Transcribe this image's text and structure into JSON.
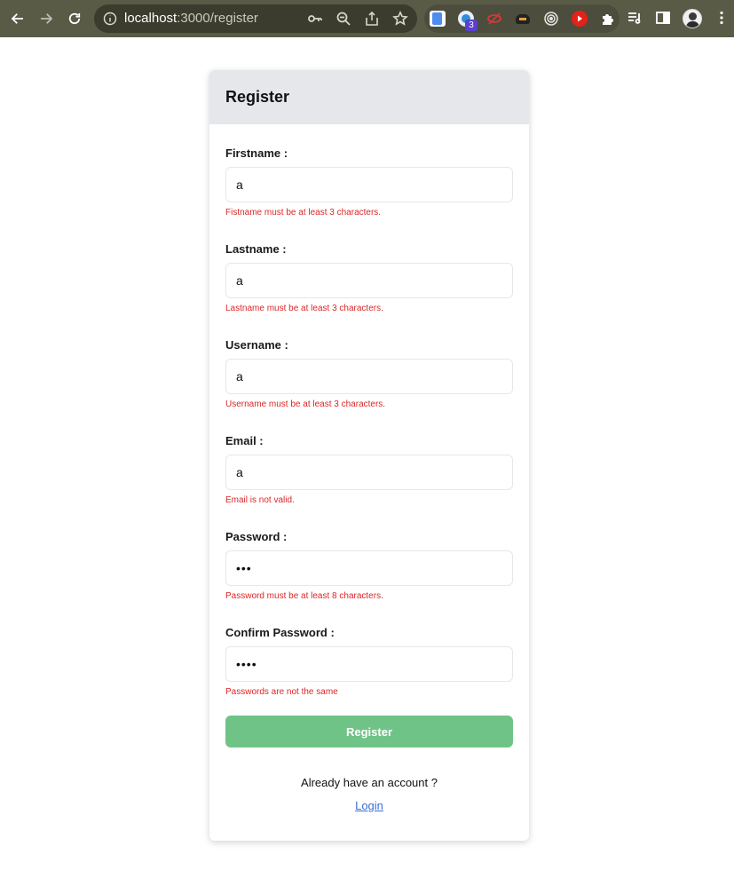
{
  "browser": {
    "url_host": "localhost",
    "url_path": ":3000/register",
    "extension_badge": "3"
  },
  "page": {
    "title": "Register",
    "fields": [
      {
        "label": "Firstname :",
        "value": "a",
        "error": "Fistname must be at least 3 characters."
      },
      {
        "label": "Lastname :",
        "value": "a",
        "error": "Lastname must be at least 3 characters."
      },
      {
        "label": "Username :",
        "value": "a",
        "error": "Username must be at least 3 characters."
      },
      {
        "label": "Email :",
        "value": "a",
        "error": "Email is not valid."
      },
      {
        "label": "Password :",
        "value": "•••",
        "error": "Password must be at least 8 characters."
      },
      {
        "label": "Confirm Password :",
        "value": "••••",
        "error": "Passwords are not the same"
      }
    ],
    "submit_label": "Register",
    "account_prompt": "Already have an account ?",
    "login_link": "Login"
  },
  "colors": {
    "header_bg": "#e5e7eb",
    "error": "#dc2626",
    "submit_bg": "#6fc386",
    "link": "#3b6fd6",
    "chrome_bg": "#5a5b46"
  },
  "icons": [
    "back-arrow-icon",
    "forward-arrow-icon",
    "reload-icon",
    "info-icon",
    "key-icon",
    "zoom-out-icon",
    "share-icon",
    "star-icon",
    "puzzle-icon",
    "media-icon",
    "side-panel-icon",
    "kebab-menu-icon"
  ]
}
